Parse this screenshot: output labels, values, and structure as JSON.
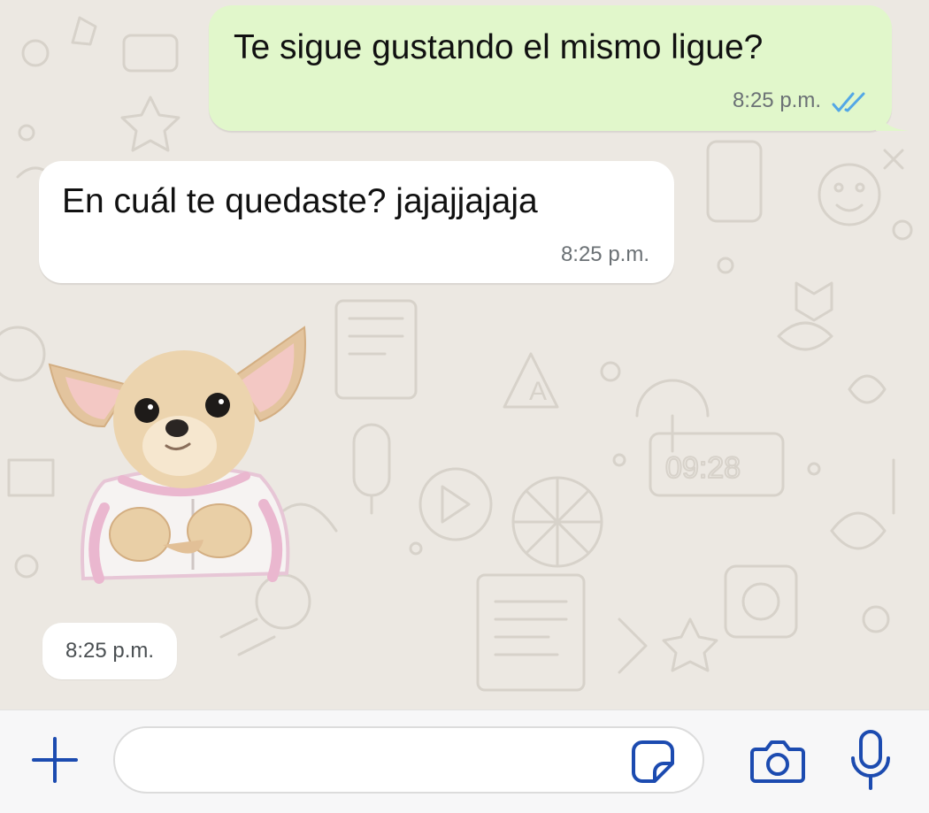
{
  "colors": {
    "chat_background": "#ece8e2",
    "outgoing_bubble": "#e1f7cb",
    "incoming_bubble": "#ffffff",
    "read_ticks": "#53a7e6",
    "accent_icons": "#1c4bb0"
  },
  "messages": [
    {
      "direction": "outgoing",
      "text": "Te sigue gustando el mismo ligue?",
      "time": "8:25 p.m.",
      "status_icon": "double-check-read-icon"
    },
    {
      "direction": "incoming",
      "text": "En cuál te quedaste? jajajjajaja",
      "time": "8:25 p.m."
    },
    {
      "direction": "incoming",
      "type": "sticker",
      "sticker_icon": "chihuahua-sticker",
      "time": "8:25 p.m."
    }
  ],
  "input_bar": {
    "attach_icon": "plus-icon",
    "message_placeholder": "",
    "message_value": "",
    "sticker_icon": "sticker-icon",
    "camera_icon": "camera-icon",
    "mic_icon": "microphone-icon"
  },
  "background_doodle_text": "09:28"
}
